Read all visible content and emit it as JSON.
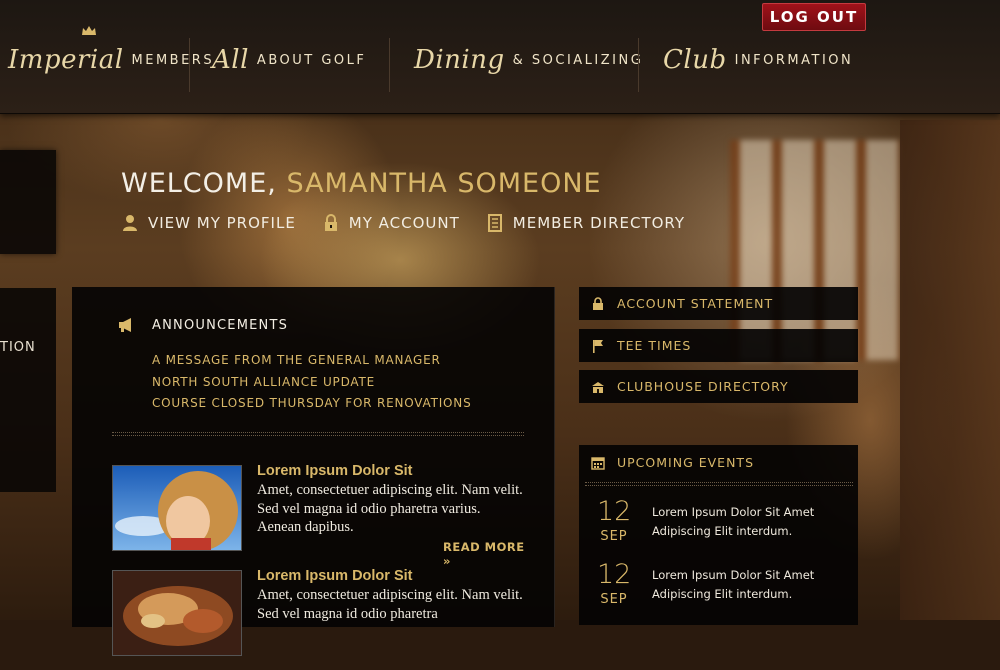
{
  "header": {
    "logout_label": "LOG OUT",
    "nav": [
      {
        "script": "Imperial",
        "plain": "MEMBERS"
      },
      {
        "script": "All",
        "plain": "ABOUT GOLF"
      },
      {
        "script": "Dining",
        "plain": "& SOCIALIZING"
      },
      {
        "script": "Club",
        "plain": "INFORMATION"
      }
    ]
  },
  "left_panel": {
    "partial_label": "TION"
  },
  "welcome": {
    "greeting": "WELCOME, ",
    "name": "SAMANTHA SOMEONE",
    "links": [
      {
        "label": "VIEW MY PROFILE",
        "icon": "user-icon"
      },
      {
        "label": "MY ACCOUNT",
        "icon": "lock-icon"
      },
      {
        "label": "MEMBER DIRECTORY",
        "icon": "directory-book-icon"
      }
    ]
  },
  "announcements": {
    "title": "ANNOUNCEMENTS",
    "items": [
      "A MESSAGE FROM THE GENERAL MANAGER",
      "NORTH SOUTH ALLIANCE UPDATE",
      "COURSE CLOSED THURSDAY FOR RENOVATIONS"
    ]
  },
  "posts": [
    {
      "title": "Lorem Ipsum Dolor Sit",
      "body": "Amet, consectetuer adipiscing elit. Nam velit. Sed vel magna id odio pharetra varius. Aenean dapibus.",
      "read_more": "READ MORE »"
    },
    {
      "title": "Lorem Ipsum Dolor Sit",
      "body": "Amet, consectetuer adipiscing elit. Nam velit. Sed vel magna id odio pharetra"
    }
  ],
  "quick_actions": [
    {
      "label": "ACCOUNT STATEMENT",
      "icon": "lock-icon"
    },
    {
      "label": "TEE TIMES",
      "icon": "flag-icon"
    },
    {
      "label": "CLUBHOUSE DIRECTORY",
      "icon": "clubhouse-icon"
    }
  ],
  "events": {
    "title": "UPCOMING EVENTS",
    "items": [
      {
        "day": "12",
        "month": "SEP",
        "text": "Lorem Ipsum Dolor Sit Amet Adipiscing Elit interdum."
      },
      {
        "day": "12",
        "month": "SEP",
        "text": "Lorem Ipsum Dolor Sit Amet Adipiscing Elit interdum."
      }
    ]
  },
  "colors": {
    "accent_gold": "#d9b86a",
    "logout_red": "#8a0f15"
  }
}
